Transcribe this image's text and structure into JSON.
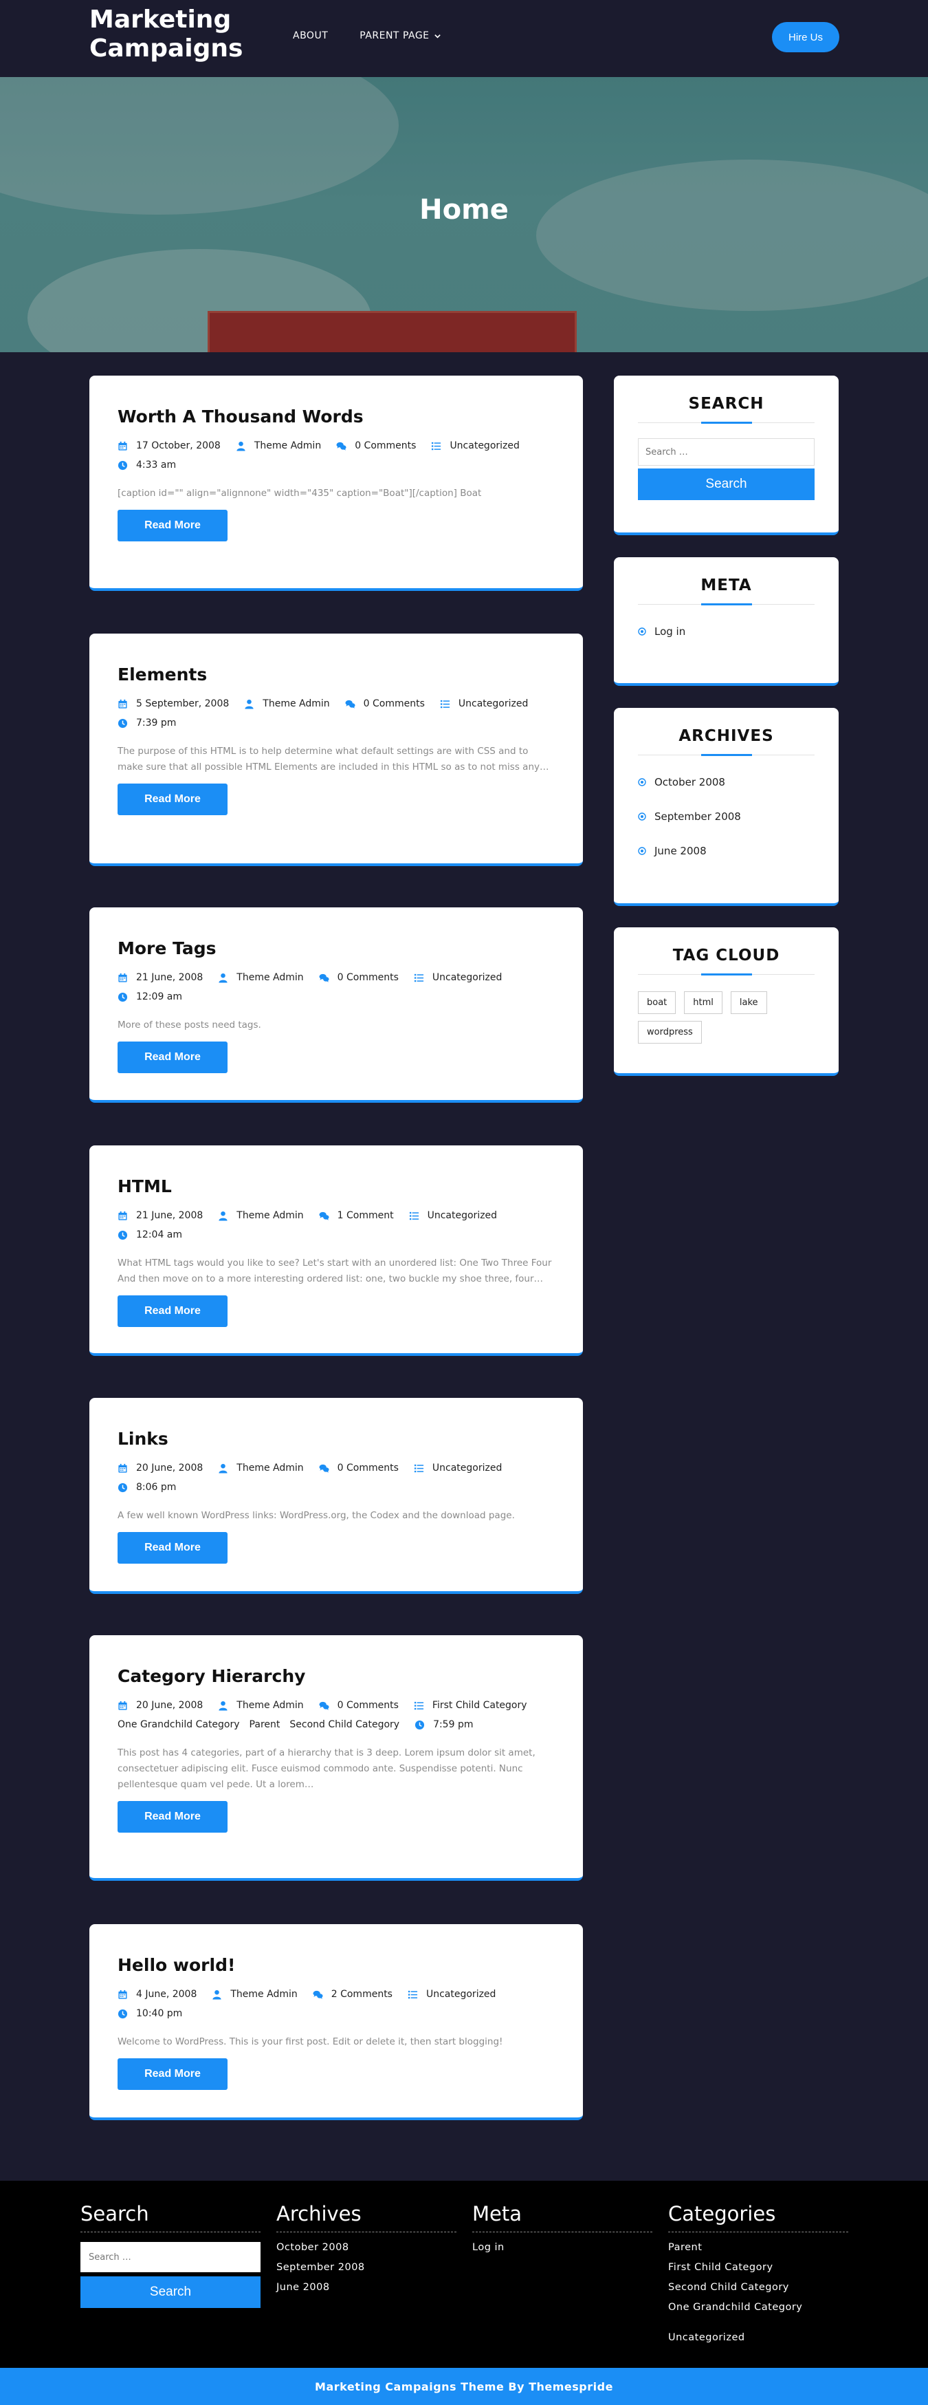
{
  "header": {
    "site_title": "Marketing Campaigns",
    "nav": [
      {
        "label": "ABOUT"
      },
      {
        "label": "PARENT PAGE"
      }
    ],
    "hire_label": "Hire Us"
  },
  "hero": {
    "title": "Home"
  },
  "posts": [
    {
      "title": "Worth A Thousand Words",
      "date": "17 October, 2008",
      "author": "Theme Admin",
      "comments": "0 Comments",
      "categories": [
        "Uncategorized"
      ],
      "time": "4:33 am",
      "excerpt": "[caption id=\"\" align=\"alignnone\" width=\"435\" caption=\"Boat\"][/caption] Boat",
      "read_more": "Read More"
    },
    {
      "title": "Elements",
      "date": "5 September, 2008",
      "author": "Theme Admin",
      "comments": "0 Comments",
      "categories": [
        "Uncategorized"
      ],
      "time": "7:39 pm",
      "excerpt": "The purpose of this HTML is to help determine what default settings are with CSS and to make sure that all possible HTML Elements are included in this HTML so as to not miss any…",
      "read_more": "Read More"
    },
    {
      "title": "More Tags",
      "date": "21 June, 2008",
      "author": "Theme Admin",
      "comments": "0 Comments",
      "categories": [
        "Uncategorized"
      ],
      "time": "12:09 am",
      "excerpt": "More of these posts need tags.",
      "read_more": "Read More"
    },
    {
      "title": "HTML",
      "date": "21 June, 2008",
      "author": "Theme Admin",
      "comments": "1 Comment",
      "categories": [
        "Uncategorized"
      ],
      "time": "12:04 am",
      "excerpt": "What HTML tags would you like to see? Let's start with an unordered list: One Two Three Four And then move on to a more interesting ordered list: one, two buckle my shoe three, four…",
      "read_more": "Read More"
    },
    {
      "title": "Links",
      "date": "20 June, 2008",
      "author": "Theme Admin",
      "comments": "0 Comments",
      "categories": [
        "Uncategorized"
      ],
      "time": "8:06 pm",
      "excerpt": "A few well known WordPress links: WordPress.org, the Codex and the download page.",
      "read_more": "Read More"
    },
    {
      "title": "Category Hierarchy",
      "date": "20 June, 2008",
      "author": "Theme Admin",
      "comments": "0 Comments",
      "categories": [
        "First Child Category",
        "One Grandchild Category",
        "Parent",
        "Second Child Category"
      ],
      "time": "7:59 pm",
      "excerpt": "This post has 4 categories, part of a hierarchy that is 3 deep. Lorem ipsum dolor sit amet, consectetuer adipiscing elit. Fusce euismod commodo ante. Suspendisse potenti. Nunc pellentesque quam vel pede. Ut a lorem…",
      "read_more": "Read More"
    },
    {
      "title": "Hello world!",
      "date": "4 June, 2008",
      "author": "Theme Admin",
      "comments": "2 Comments",
      "categories": [
        "Uncategorized"
      ],
      "time": "10:40 pm",
      "excerpt": "Welcome to WordPress. This is your first post. Edit or delete it, then start blogging!",
      "read_more": "Read More"
    }
  ],
  "sidebar": {
    "search": {
      "title": "SEARCH",
      "placeholder": "Search …",
      "button": "Search"
    },
    "meta": {
      "title": "META",
      "items": [
        "Log in"
      ]
    },
    "archives": {
      "title": "ARCHIVES",
      "items": [
        "October 2008",
        "September 2008",
        "June 2008"
      ]
    },
    "tag_cloud": {
      "title": "TAG CLOUD",
      "tags": [
        "boat",
        "html",
        "lake",
        "wordpress"
      ]
    }
  },
  "footer": {
    "search": {
      "title": "Search",
      "placeholder": "Search …",
      "button": "Search"
    },
    "archives": {
      "title": "Archives",
      "items": [
        "October 2008",
        "September 2008",
        "June 2008"
      ]
    },
    "meta": {
      "title": "Meta",
      "items": [
        "Log in"
      ]
    },
    "categories": {
      "title": "Categories",
      "items": [
        "Parent",
        "First Child Category",
        "Second Child Category",
        "One Grandchild Category",
        "Uncategorized"
      ]
    },
    "copyright": "Marketing Campaigns Theme By Themespride"
  },
  "colors": {
    "accent": "#1b8ef5",
    "background": "#1b1b2e",
    "footer": "#000000"
  }
}
